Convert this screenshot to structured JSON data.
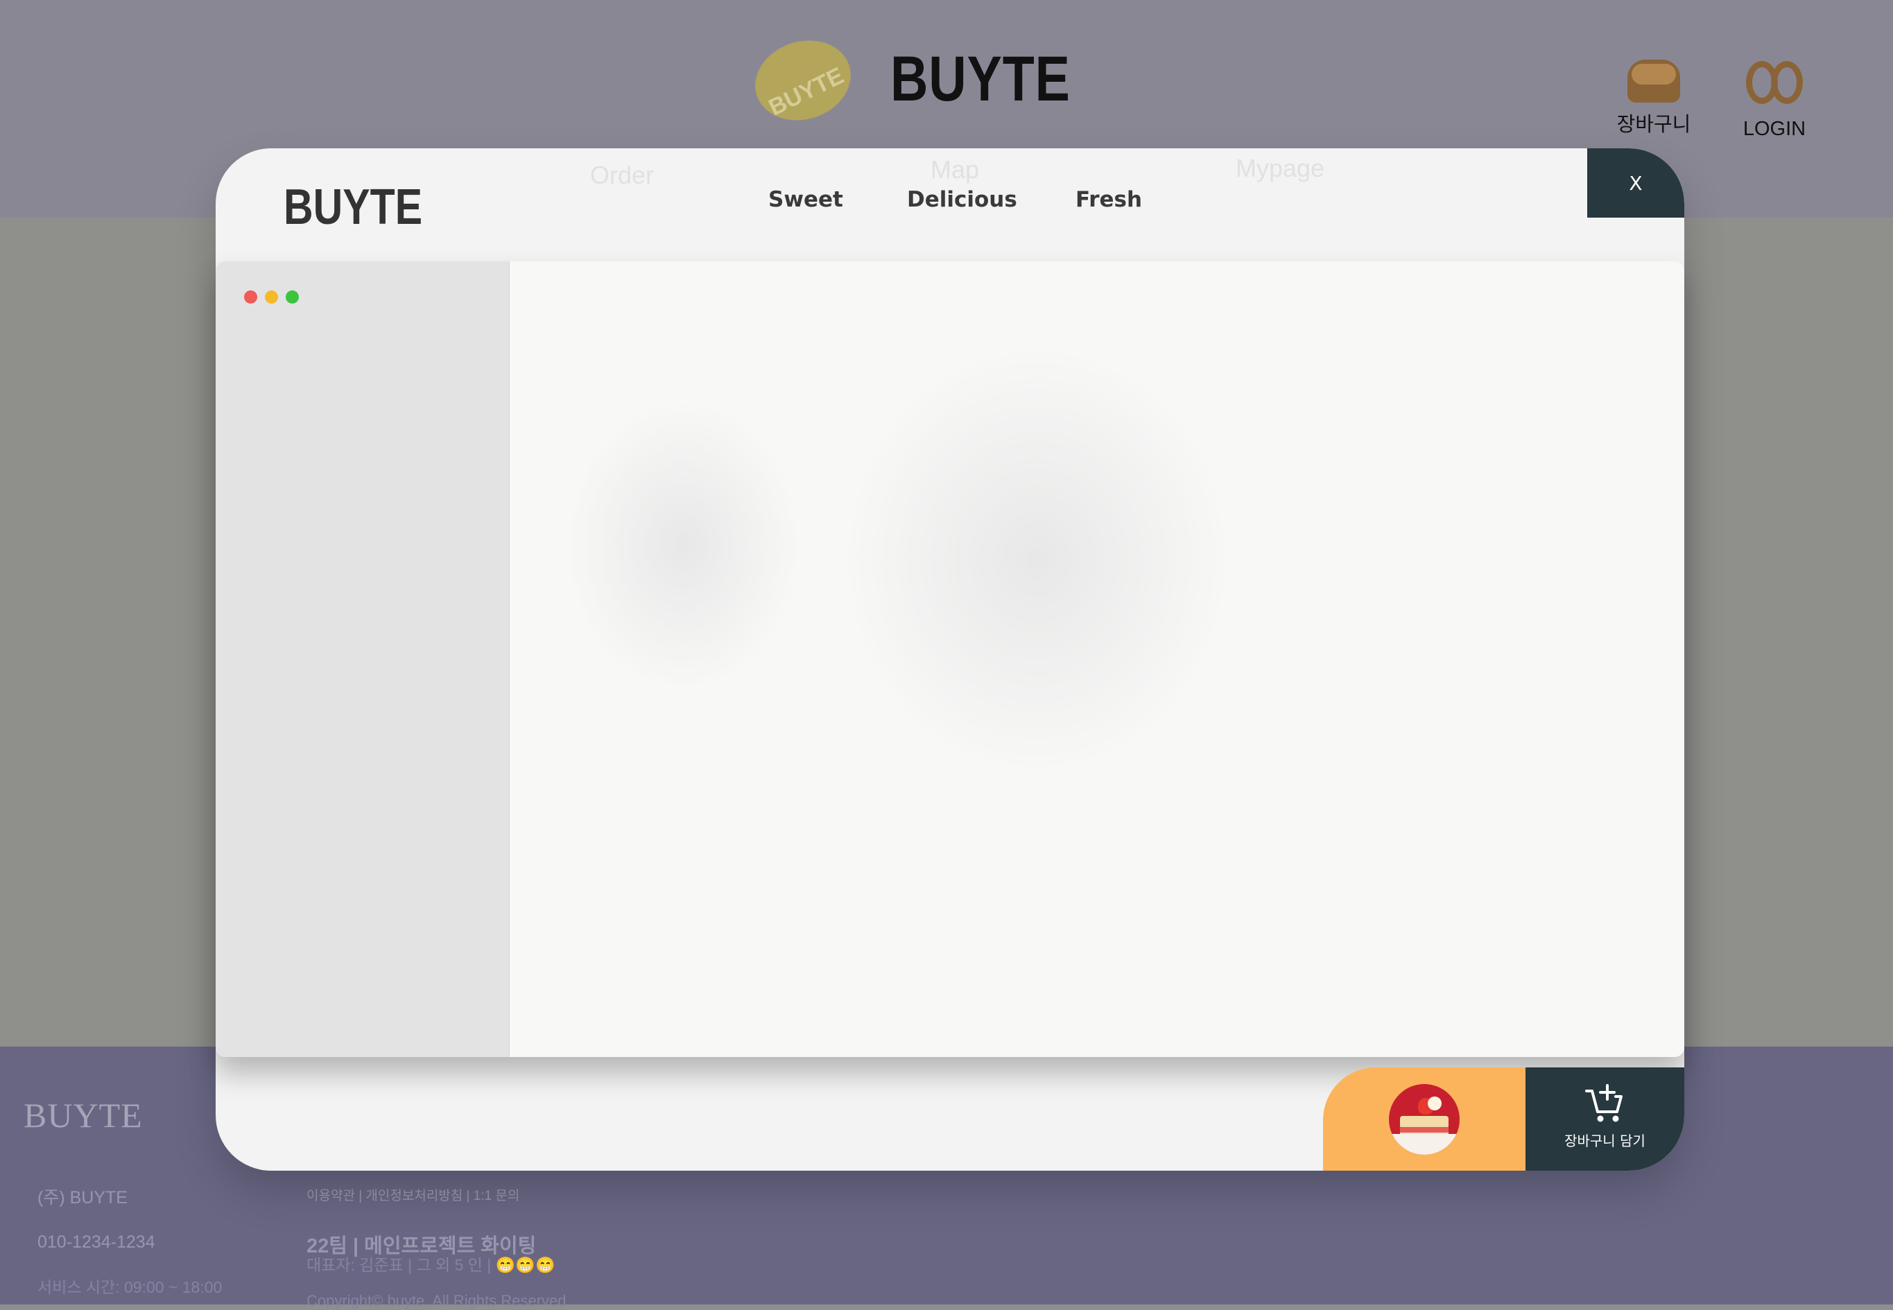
{
  "background_page": {
    "brand": "BUYTE",
    "logo_badge_text": "BUYTE",
    "cart_label": "장바구니",
    "login_label": "LOGIN",
    "nav": [
      "Order",
      "Map",
      "Mypage"
    ],
    "footer": {
      "logo": "BUYTE",
      "company": "(주) BUYTE",
      "phone": "010-1234-1234",
      "hours": "서비스 시간: 09:00 ~ 18:00",
      "links": "이용약관 | 개인정보처리방침 | 1:1 문의",
      "team": "22팀 | 메인프로젝트 화이팅",
      "representative": "대표자: 김준표 | 그 외 5 인 | 😁😁😁",
      "copyright": "Copyright© buyte. All Rights Reserved"
    }
  },
  "modal": {
    "brand": "BUYTE",
    "tabs": [
      "Sweet",
      "Delicious",
      "Fresh"
    ],
    "close_label": "X",
    "cart_button_label": "장바구니 담기"
  },
  "colors": {
    "accent_dark": "#27383f",
    "accent_orange": "#fbb45b",
    "footer_bg": "#686683"
  }
}
